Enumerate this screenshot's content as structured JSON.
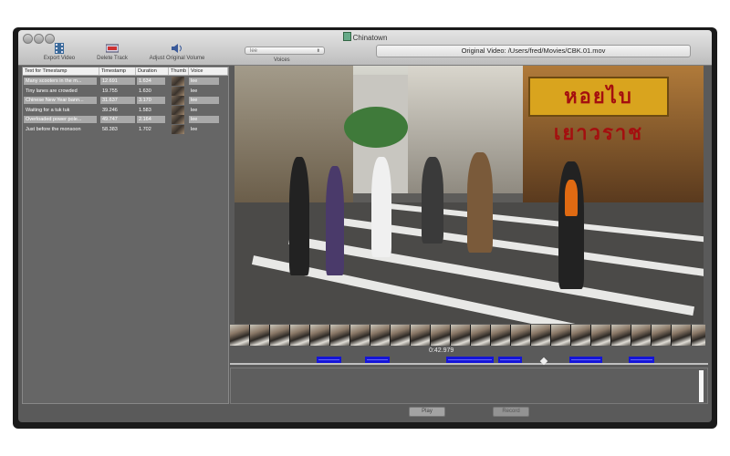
{
  "window": {
    "title": "Chinatown"
  },
  "toolbar": {
    "export_label": "Export Video",
    "delete_label": "Delete Track",
    "adjust_label": "Adjust Original Volume"
  },
  "voices": {
    "selected": "lee",
    "label": "Voices"
  },
  "original_video": {
    "text": "Original Video: /Users/fred/Movies/CBK.01.mov"
  },
  "table": {
    "headers": [
      "Text for Timestamp",
      "Timestamp",
      "Duration",
      "Thumb",
      "Voice"
    ],
    "rows": [
      {
        "text": "Many scooters in the m...",
        "timestamp": "12.691",
        "duration": "1.634",
        "voice": "lee",
        "selected": true
      },
      {
        "text": "Tiny lanes are crowded",
        "timestamp": "19.755",
        "duration": "1.630",
        "voice": "lee",
        "selected": false
      },
      {
        "text": "Chinese New Year bann...",
        "timestamp": "31.637",
        "duration": "3.170",
        "voice": "lee",
        "selected": true
      },
      {
        "text": "Waiting for a tuk tuk",
        "timestamp": "39.246",
        "duration": "1.583",
        "voice": "lee",
        "selected": false
      },
      {
        "text": "Overloaded power pole...",
        "timestamp": "49.747",
        "duration": "2.164",
        "voice": "lee",
        "selected": true
      },
      {
        "text": "Just before the monsoon",
        "timestamp": "58.383",
        "duration": "1.702",
        "voice": "lee",
        "selected": false
      }
    ]
  },
  "video": {
    "sign_text": "หอยไบเยาวราช"
  },
  "timeline": {
    "current_time": "0:42.979"
  },
  "controls": {
    "play_label": "Play",
    "record_label": "Record"
  }
}
